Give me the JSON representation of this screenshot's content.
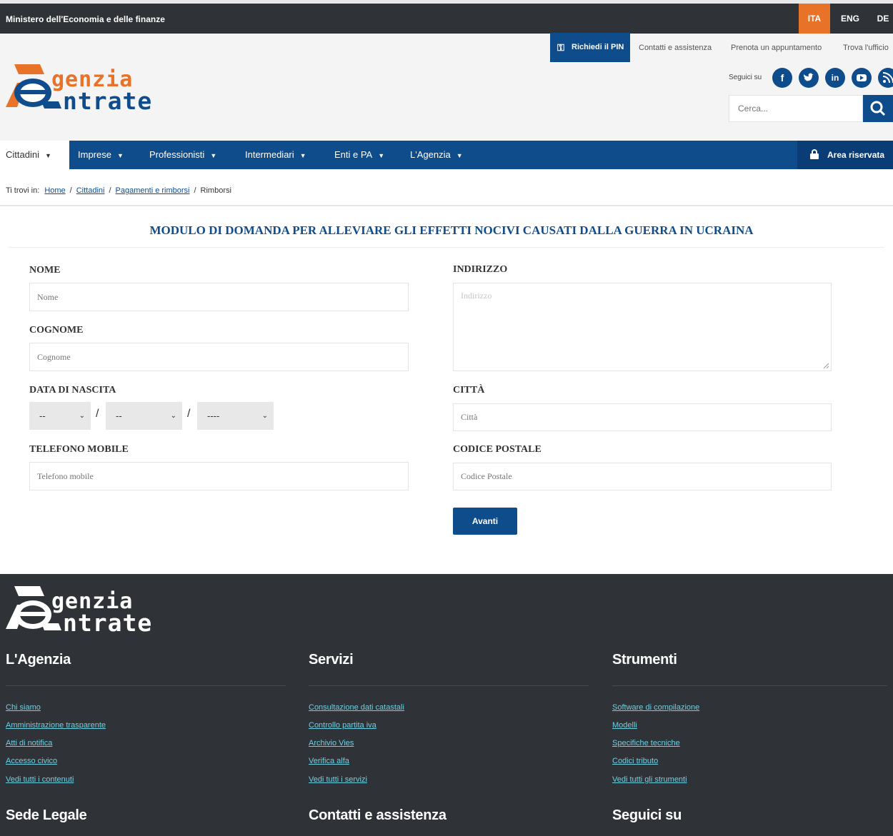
{
  "topbar": {
    "ministry": "Ministero dell'Economia e delle finanze",
    "languages": [
      "ITA",
      "ENG",
      "DE"
    ]
  },
  "header": {
    "logo_line1": "genzia",
    "logo_line2": "ntrate",
    "pin_button": "Richiedi il PIN",
    "links": [
      "Contatti e assistenza",
      "Prenota un appuntamento",
      "Trova l'ufficio"
    ],
    "follow_label": "Seguici su",
    "search_placeholder": "Cerca..."
  },
  "nav": {
    "items": [
      "Cittadini",
      "Imprese",
      "Professionisti",
      "Intermediari",
      "Enti e PA",
      "L'Agenzia"
    ],
    "reserved_area": "Area riservata"
  },
  "breadcrumb": {
    "prefix": "Ti trovi in:",
    "items": [
      "Home",
      "Cittadini",
      "Pagamenti e rimborsi",
      "Rimborsi"
    ]
  },
  "form": {
    "title": "MODULO DI DOMANDA PER ALLEVIARE GLI EFFETTI NOCIVI CAUSATI DALLA GUERRA IN UCRAINA",
    "nome_label": "NOME",
    "nome_placeholder": "Nome",
    "cognome_label": "COGNOME",
    "cognome_placeholder": "Cognome",
    "nascita_label": "DATA DI NASCITA",
    "day_value": "--",
    "month_value": "--",
    "year_value": "----",
    "date_separator": "/",
    "telefono_label": "TELEFONO MOBILE",
    "telefono_placeholder": "Telefono mobile",
    "indirizzo_label": "INDIRIZZO",
    "indirizzo_placeholder": "Indirizzo",
    "citta_label": "CITTÀ",
    "citta_placeholder": "Città",
    "cap_label": "CODICE POSTALE",
    "cap_placeholder": "Codice Postale",
    "submit": "Avanti"
  },
  "footer": {
    "logo_line1": "genzia",
    "logo_line2": "ntrate",
    "columns": [
      {
        "title": "L'Agenzia",
        "links": [
          "Chi siamo",
          "Amministrazione trasparente",
          "Atti di notifica",
          "Accesso civico",
          "Vedi tutti i contenuti"
        ]
      },
      {
        "title": "Servizi",
        "links": [
          "Consultazione dati catastali",
          "Controllo partita iva",
          "Archivio Vies",
          "Verifica alfa",
          "Vedi tutti i servizi"
        ]
      },
      {
        "title": "Strumenti",
        "links": [
          "Software di compilazione",
          "Modelli",
          "Specifiche tecniche",
          "Codici tributo",
          "Vedi tutti gli strumenti"
        ]
      }
    ],
    "bottom": [
      "Sede Legale",
      "Contatti e assistenza",
      "Seguici su"
    ]
  },
  "colors": {
    "brand_blue": "#0f4c8c",
    "brand_orange": "#e87228",
    "dark": "#2f3337",
    "footer_link": "#6fd0e2"
  }
}
